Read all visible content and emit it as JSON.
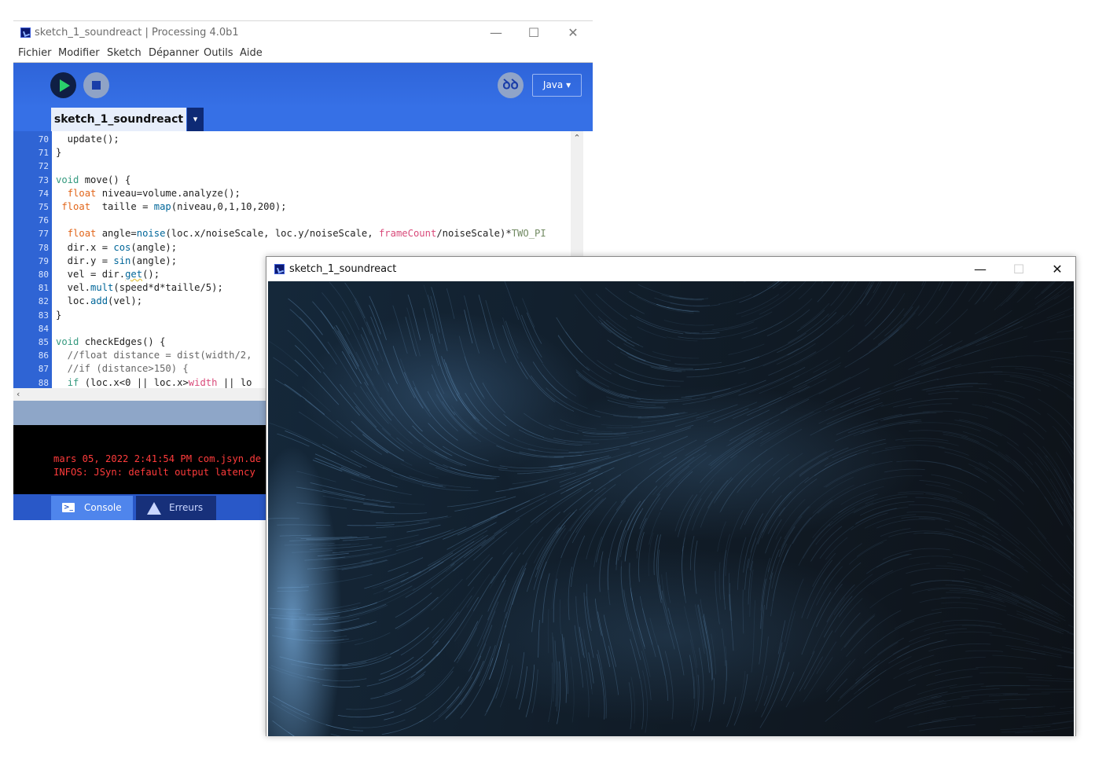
{
  "ide": {
    "title": "sketch_1_soundreact | Processing 4.0b1",
    "window_controls": {
      "minimize": "—",
      "maximize": "☐",
      "close": "✕"
    },
    "menu": [
      "Fichier",
      "Modifier",
      "Sketch",
      "Dépanner",
      "Outils",
      "Aide"
    ],
    "toolbar": {
      "run_icon": "play-icon",
      "stop_icon": "stop-icon",
      "debug_icon": "butterfly-icon",
      "debug_label": "ꝺꝺ",
      "mode_label": "Java ▾"
    },
    "tab": {
      "label": "sketch_1_soundreact",
      "menu_glyph": "▾"
    },
    "scroll": {
      "up": "⌃",
      "left": "‹"
    },
    "code": [
      {
        "line": "70",
        "tokens": [
          {
            "t": "  update();"
          }
        ]
      },
      {
        "line": "71",
        "tokens": [
          {
            "t": "}"
          }
        ]
      },
      {
        "line": "72",
        "tokens": []
      },
      {
        "line": "73",
        "tokens": [
          {
            "t": "void",
            "c": "kw"
          },
          {
            "t": " move() {"
          }
        ]
      },
      {
        "line": "74",
        "tokens": [
          {
            "t": "  "
          },
          {
            "t": "float",
            "c": "type"
          },
          {
            "t": " niveau=volume.analyze();"
          }
        ]
      },
      {
        "line": "75",
        "tokens": [
          {
            "t": " "
          },
          {
            "t": "float",
            "c": "type"
          },
          {
            "t": "  taille = "
          },
          {
            "t": "map",
            "c": "fn"
          },
          {
            "t": "(niveau,0,1,10,200);"
          }
        ]
      },
      {
        "line": "76",
        "tokens": []
      },
      {
        "line": "77",
        "tokens": [
          {
            "t": "  "
          },
          {
            "t": "float",
            "c": "type"
          },
          {
            "t": " angle="
          },
          {
            "t": "noise",
            "c": "fn"
          },
          {
            "t": "(loc.x/noiseScale, loc.y/noiseScale, "
          },
          {
            "t": "frameCount",
            "c": "var"
          },
          {
            "t": "/noiseScale)*"
          },
          {
            "t": "TWO_PI",
            "c": "const"
          }
        ]
      },
      {
        "line": "78",
        "tokens": [
          {
            "t": "  dir.x = "
          },
          {
            "t": "cos",
            "c": "fn"
          },
          {
            "t": "(angle);"
          }
        ]
      },
      {
        "line": "79",
        "tokens": [
          {
            "t": "  dir.y = "
          },
          {
            "t": "sin",
            "c": "fn"
          },
          {
            "t": "(angle);"
          }
        ]
      },
      {
        "line": "80",
        "tokens": [
          {
            "t": "  vel = dir."
          },
          {
            "t": "get",
            "c": "fnu"
          },
          {
            "t": "();"
          }
        ]
      },
      {
        "line": "81",
        "tokens": [
          {
            "t": "  vel."
          },
          {
            "t": "mult",
            "c": "fn"
          },
          {
            "t": "(speed*d*taille/5);"
          }
        ]
      },
      {
        "line": "82",
        "tokens": [
          {
            "t": "  loc."
          },
          {
            "t": "add",
            "c": "fn"
          },
          {
            "t": "(vel);"
          }
        ]
      },
      {
        "line": "83",
        "tokens": [
          {
            "t": "}"
          }
        ]
      },
      {
        "line": "84",
        "tokens": []
      },
      {
        "line": "85",
        "tokens": [
          {
            "t": "void",
            "c": "kw"
          },
          {
            "t": " checkEdges() {"
          }
        ]
      },
      {
        "line": "86",
        "tokens": [
          {
            "t": "  //float distance = dist(width/2,",
            "c": "comment"
          }
        ]
      },
      {
        "line": "87",
        "tokens": [
          {
            "t": "  //if (distance>150) {",
            "c": "comment"
          }
        ]
      },
      {
        "line": "88",
        "tokens": [
          {
            "t": "  "
          },
          {
            "t": "if",
            "c": "kw"
          },
          {
            "t": " (loc.x<0 || loc.x>"
          },
          {
            "t": "width",
            "c": "var"
          },
          {
            "t": " || lo"
          }
        ]
      }
    ],
    "console_lines": [
      "mars 05, 2022 2:41:54 PM com.jsyn.de",
      "INFOS: JSyn: default output latency"
    ],
    "footer_tabs": [
      {
        "label": "Console",
        "icon": "console-icon"
      },
      {
        "label": "Erreurs",
        "icon": "warning-icon"
      }
    ]
  },
  "sketch_window": {
    "title": "sketch_1_soundreact",
    "window_controls": {
      "minimize": "—",
      "maximize": "☐",
      "close": "✕"
    }
  },
  "colors": {
    "ide_blue": "#3670e6",
    "keyword": "#33997e",
    "type": "#e2661a",
    "function": "#006699",
    "variable": "#d94a7a",
    "constant": "#718a62",
    "comment": "#666666",
    "console_text": "#ff3b3b",
    "sketch_background": "#111d29",
    "particle_light": "#7ab0e2"
  }
}
